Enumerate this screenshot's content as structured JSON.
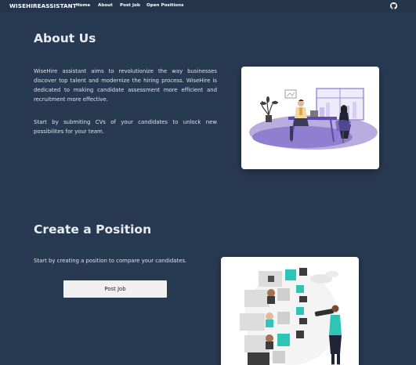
{
  "navbar": {
    "brand": "WISEHIREASSISTANT",
    "links": [
      "Home",
      "About",
      "Post Job",
      "Open Positions"
    ],
    "github_icon": "github-icon"
  },
  "about": {
    "title": "About Us",
    "paragraph1": "WiseHire assistant aims to revolutionize the way businesses discover top talent and modernize the hiring process. WiseHire is dedicated to making candidate assessment more efficient and recruitment more effective.",
    "paragraph2": "Start by submiting CVs of your candidates to unlock new possibilites for your team.",
    "illustration": "meeting-illustration"
  },
  "create": {
    "title": "Create a Position",
    "paragraph": "Start by creating a position to compare your candidates.",
    "button_label": "Post Job",
    "illustration": "candidate-search-illustration"
  },
  "colors": {
    "background": "#283a52",
    "navbar": "#25364c",
    "accent_purple": "#7b68c8",
    "accent_teal": "#2ec4b6"
  }
}
